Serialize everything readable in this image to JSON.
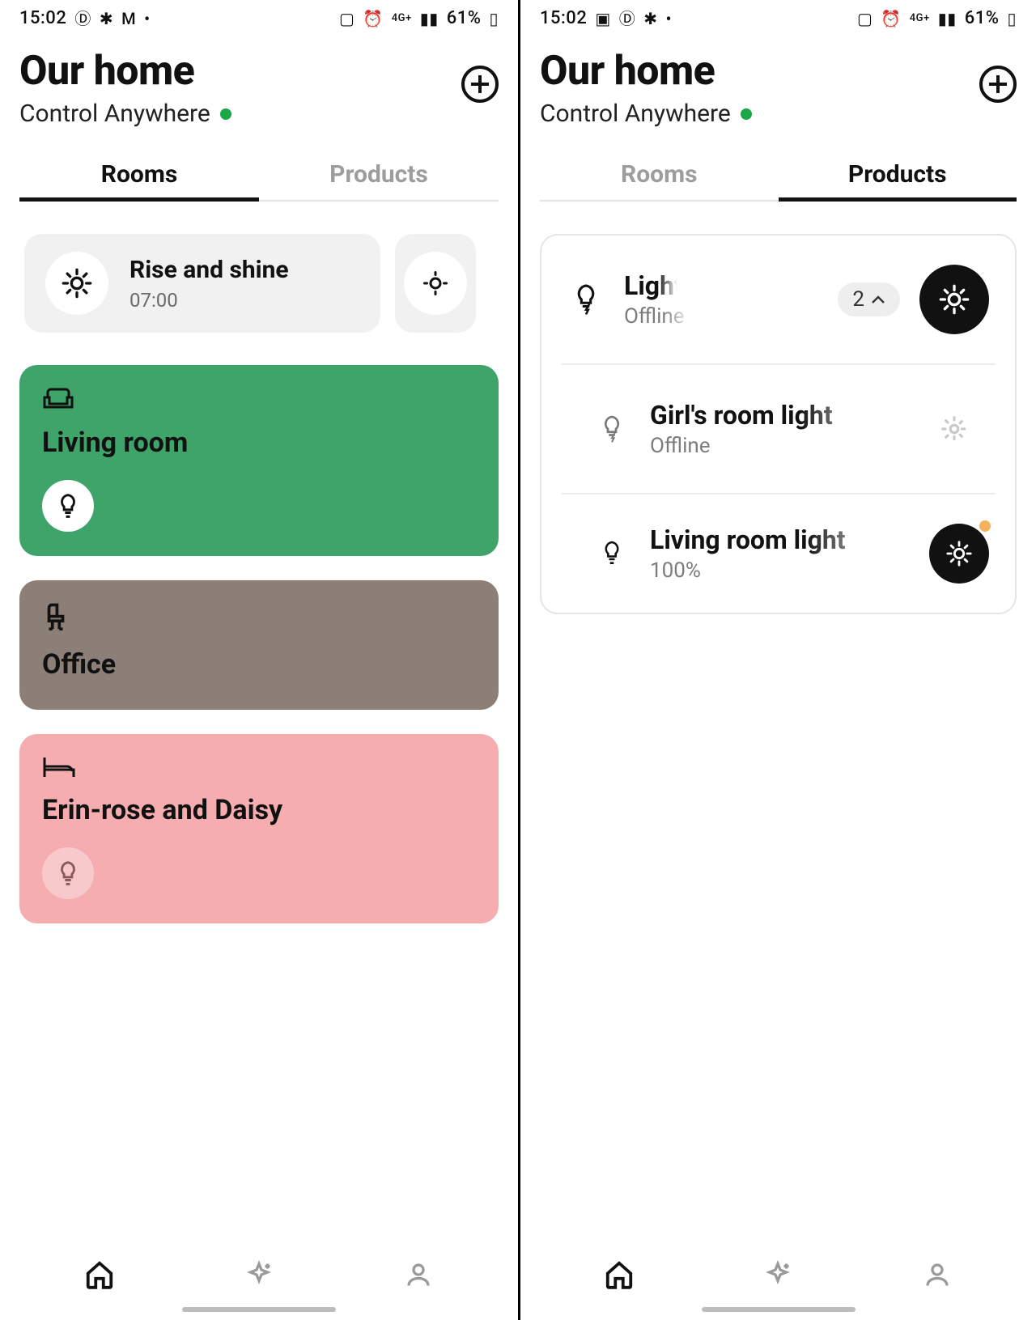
{
  "statusbar": {
    "time": "15:02",
    "battery": "61%",
    "signal": "4G+"
  },
  "header": {
    "title": "Our home",
    "subtitle": "Control Anywhere"
  },
  "tabs": {
    "rooms": "Rooms",
    "products": "Products"
  },
  "scenes": [
    {
      "name": "Rise and shine",
      "time": "07:00",
      "icon": "sun"
    }
  ],
  "rooms": [
    {
      "name": "Living room",
      "color": "#3fa46a",
      "icon": "sofa",
      "has_light_chip": true,
      "chip_style": "white"
    },
    {
      "name": "Office",
      "color": "#8c7f78",
      "icon": "chair",
      "has_light_chip": false
    },
    {
      "name": "Erin-rose and Daisy",
      "color": "#f5adb0",
      "icon": "bed",
      "has_light_chip": true,
      "chip_style": "faint"
    }
  ],
  "products": {
    "group": {
      "name": "Lights",
      "status": "Offline",
      "count": "2",
      "toggle": "on"
    },
    "items": [
      {
        "name": "Girl's room light",
        "status": "Offline",
        "toggle": "off",
        "icon": "bolt"
      },
      {
        "name": "Living room light",
        "status": "100%",
        "toggle": "on",
        "icon": "bulb",
        "notify": true
      }
    ]
  }
}
